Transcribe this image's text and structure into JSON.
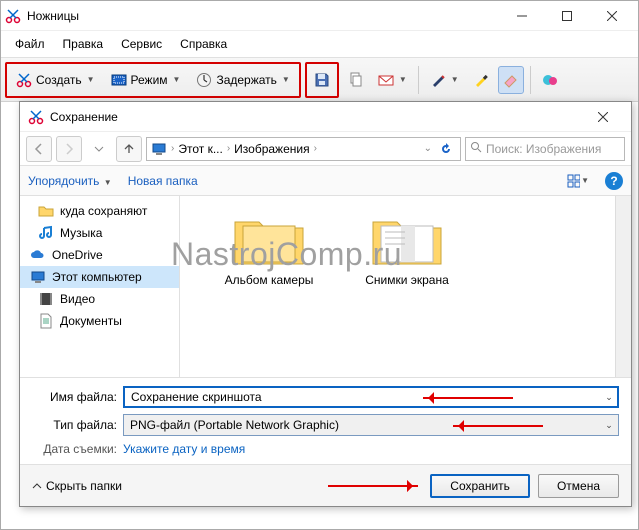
{
  "app": {
    "title": "Ножницы",
    "menu": [
      "Файл",
      "Правка",
      "Сервис",
      "Справка"
    ],
    "toolbar": {
      "new_label": "Создать",
      "mode_label": "Режим",
      "delay_label": "Задержать"
    }
  },
  "dialog": {
    "title": "Сохранение",
    "breadcrumb": {
      "seg1": "Этот к...",
      "seg2": "Изображения"
    },
    "search_placeholder": "Поиск: Изображения",
    "cmdbar": {
      "organize": "Упорядочить",
      "new_folder": "Новая папка"
    },
    "side_items": [
      {
        "id": "save-to",
        "label": "куда сохраняют",
        "icon": "folder"
      },
      {
        "id": "music",
        "label": "Музыка",
        "icon": "music"
      },
      {
        "id": "onedrive",
        "label": "OneDrive",
        "icon": "cloud",
        "top": true
      },
      {
        "id": "this-pc",
        "label": "Этот компьютер",
        "icon": "pc",
        "top": true,
        "selected": true
      },
      {
        "id": "video",
        "label": "Видео",
        "icon": "film"
      },
      {
        "id": "documents",
        "label": "Документы",
        "icon": "doc"
      }
    ],
    "folders": [
      {
        "label": "Альбом камеры",
        "full": true
      },
      {
        "label": "Снимки экрана",
        "full": false
      }
    ],
    "filename_label": "Имя файла:",
    "filetype_label": "Тип файла:",
    "filename_value": "Сохранение скриншота",
    "filetype_value": "PNG-файл (Portable Network Graphic)",
    "shot_date_label": "Дата съемки:",
    "shot_date_link": "Укажите дату и время",
    "hide_folders": "Скрыть папки",
    "save_btn": "Сохранить",
    "cancel_btn": "Отмена"
  },
  "watermark": "NastrojComp.ru"
}
